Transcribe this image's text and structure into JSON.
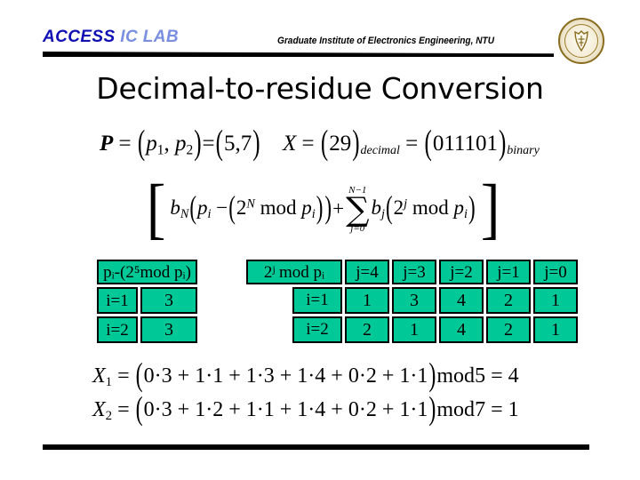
{
  "header": {
    "lab_name_bold": "ACCESS",
    "lab_name_light": "IC LAB",
    "department": "Graduate Institute of Electronics Engineering, NTU",
    "seal_name": "ntu-seal",
    "accent_blue_dark": "#1010b4",
    "accent_blue_light": "#7a8fe0",
    "rule_color": "#000000"
  },
  "title": "Decimal-to-residue Conversion",
  "equations": {
    "moduli": {
      "lhs": "P",
      "eq1": "=",
      "tuple_open": "(",
      "p1": "p",
      "p1_sub": "1",
      "comma": ",",
      "p2": "p",
      "p2_sub": "2",
      "tuple_close": ")",
      "eq2": "=",
      "values_open": "(",
      "values": "5,7",
      "values_close": ")"
    },
    "input": {
      "lhs": "X",
      "eq1": "=",
      "dec_open": "(",
      "dec_value": "29",
      "dec_close": ")",
      "dec_label": "decimal",
      "eq2": "=",
      "bin_open": "(",
      "bin_value": "011101",
      "bin_close": ")",
      "bin_label": "binary"
    },
    "summation": {
      "bracket_open": "[",
      "b_big": "b",
      "b_big_sub": "N",
      "open1": "(",
      "pi": "p",
      "pi_sub": "i",
      "minus": "−",
      "open2": "(",
      "two": "2",
      "two_sup": "N",
      "mod1": "mod",
      "pi2": "p",
      "pi2_sub": "i",
      "close2": ")",
      "close1": ")",
      "plus": "+",
      "sigma_upper": "N−1",
      "sigma": "∑",
      "sigma_lower": "j=0",
      "b_small": "b",
      "b_small_sub": "j",
      "open3": "(",
      "two2": "2",
      "two2_sup": "j",
      "mod2": "mod",
      "pi3": "p",
      "pi3_sub": "i",
      "close3": ")",
      "bracket_close": "]"
    },
    "x1": {
      "lhs": "X",
      "lhs_sub": "1",
      "eq": "=",
      "open": "(",
      "terms": [
        "0·3",
        "1·1",
        "1·3",
        "1·4",
        "0·2",
        "1·1"
      ],
      "close": ")",
      "mod_label": "mod",
      "modulus": "5",
      "result_eq": "=",
      "result": "4"
    },
    "x2": {
      "lhs": "X",
      "lhs_sub": "2",
      "eq": "=",
      "open": "(",
      "terms": [
        "0·3",
        "1·2",
        "1·1",
        "1·4",
        "0·2",
        "1·1"
      ],
      "close": ")",
      "mod_label": "mod",
      "modulus": "7",
      "result_eq": "=",
      "result": "1"
    }
  },
  "table_left": {
    "header": "pᵢ-(2⁵mod pᵢ)",
    "rows": [
      {
        "label": "i=1",
        "value": "3"
      },
      {
        "label": "i=2",
        "value": "3"
      }
    ]
  },
  "table_right": {
    "header": "2ʲ mod pᵢ",
    "columns": [
      "j=4",
      "j=3",
      "j=2",
      "j=1",
      "j=0"
    ],
    "rows": [
      {
        "label": "i=1",
        "values": [
          "1",
          "3",
          "4",
          "2",
          "1"
        ]
      },
      {
        "label": "i=2",
        "values": [
          "2",
          "1",
          "4",
          "2",
          "1"
        ]
      }
    ]
  },
  "colors": {
    "cell_green": "#00c896",
    "cell_border": "#000000",
    "seal_gold": "#8a6d1f"
  }
}
